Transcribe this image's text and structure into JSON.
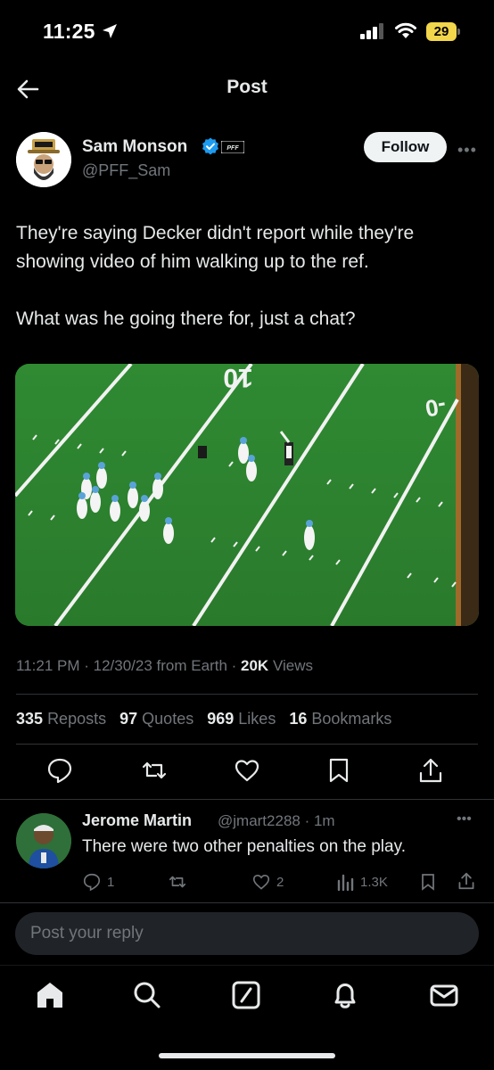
{
  "status_bar": {
    "time": "11:25",
    "battery": "29"
  },
  "nav": {
    "title": "Post",
    "back_icon": "arrow-left-icon"
  },
  "post": {
    "author_name": "Sam Monson",
    "author_handle": "@PFF_Sam",
    "badge": "PFF",
    "follow_label": "Follow",
    "text": "They're saying Decker didn't report while they're showing video of him walking up to the ref.\n\nWhat was he going there for, just a chat?",
    "meta": {
      "time": "11:21 PM",
      "date": "12/30/23",
      "source": "from Earth",
      "views_count": "20K",
      "views_label": "Views"
    },
    "stats": [
      {
        "count": "335",
        "label": "Reposts"
      },
      {
        "count": "97",
        "label": "Quotes"
      },
      {
        "count": "969",
        "label": "Likes"
      },
      {
        "count": "16",
        "label": "Bookmarks"
      }
    ],
    "media_field_text": {
      "top_number": "10",
      "right_number": "-0"
    }
  },
  "reply": {
    "name": "Jerome Martin",
    "handle_time": "@jmart2288 · 1m",
    "text": "There were two other penalties on the play.",
    "replies": "1",
    "likes": "2",
    "views": "1.3K"
  },
  "composer": {
    "placeholder": "Post your reply"
  },
  "tabs": [
    "home-icon",
    "search-icon",
    "grok-icon",
    "notifications-icon",
    "messages-icon"
  ],
  "colors": {
    "verified": "#1d9bf0",
    "battery": "#f2d64b",
    "field": "#2a7d2e"
  }
}
